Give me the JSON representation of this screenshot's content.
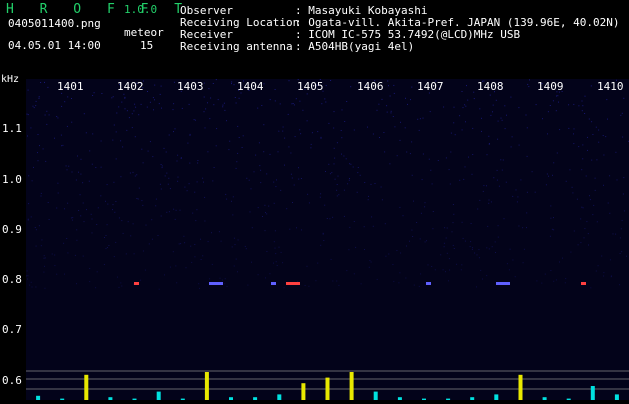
{
  "app": {
    "name": "H R O F F T",
    "version": "1.0.0"
  },
  "file": {
    "name": "0405011400.png",
    "datetime": "04.05.01 14:00"
  },
  "meteor": {
    "label": "meteor",
    "count": "15"
  },
  "info": [
    {
      "key": "Observer",
      "value": ": Masayuki Kobayashi"
    },
    {
      "key": "Receiving Location",
      "value": ": Ogata-vill. Akita-Pref. JAPAN (139.96E, 40.02N)"
    },
    {
      "key": "Receiver",
      "value": ": ICOM IC-575 53.7492(@LCD)MHz USB"
    },
    {
      "key": "Receiving antenna",
      "value": ": A504HB(yagi 4el)"
    }
  ],
  "axis": {
    "unit": "kHz",
    "x_ticks": [
      "1401",
      "1402",
      "1403",
      "1404",
      "1405",
      "1406",
      "1407",
      "1408",
      "1409",
      "1410"
    ],
    "y_ticks": [
      "1.1",
      "1.0",
      "0.9",
      "0.8",
      "0.7",
      "0.6"
    ]
  },
  "colors": {
    "bg": "#000000",
    "text": "#ffffff",
    "logo": "#22d06a",
    "bar_yellow": "#e8e800",
    "bar_cyan": "#00e0e0",
    "noise_blue": "#1a1a7a",
    "echo_red": "#ff4040",
    "echo_blue": "#6060ff"
  },
  "activity_levels": [
    0.15,
    0.05,
    0.9,
    0.1,
    0.05,
    0.3,
    0.05,
    1.0,
    0.1,
    0.1,
    0.2,
    0.6,
    0.8,
    1.0,
    0.3,
    0.1,
    0.05,
    0.05,
    0.1,
    0.2,
    0.9,
    0.1,
    0.05,
    0.5,
    0.2
  ]
}
